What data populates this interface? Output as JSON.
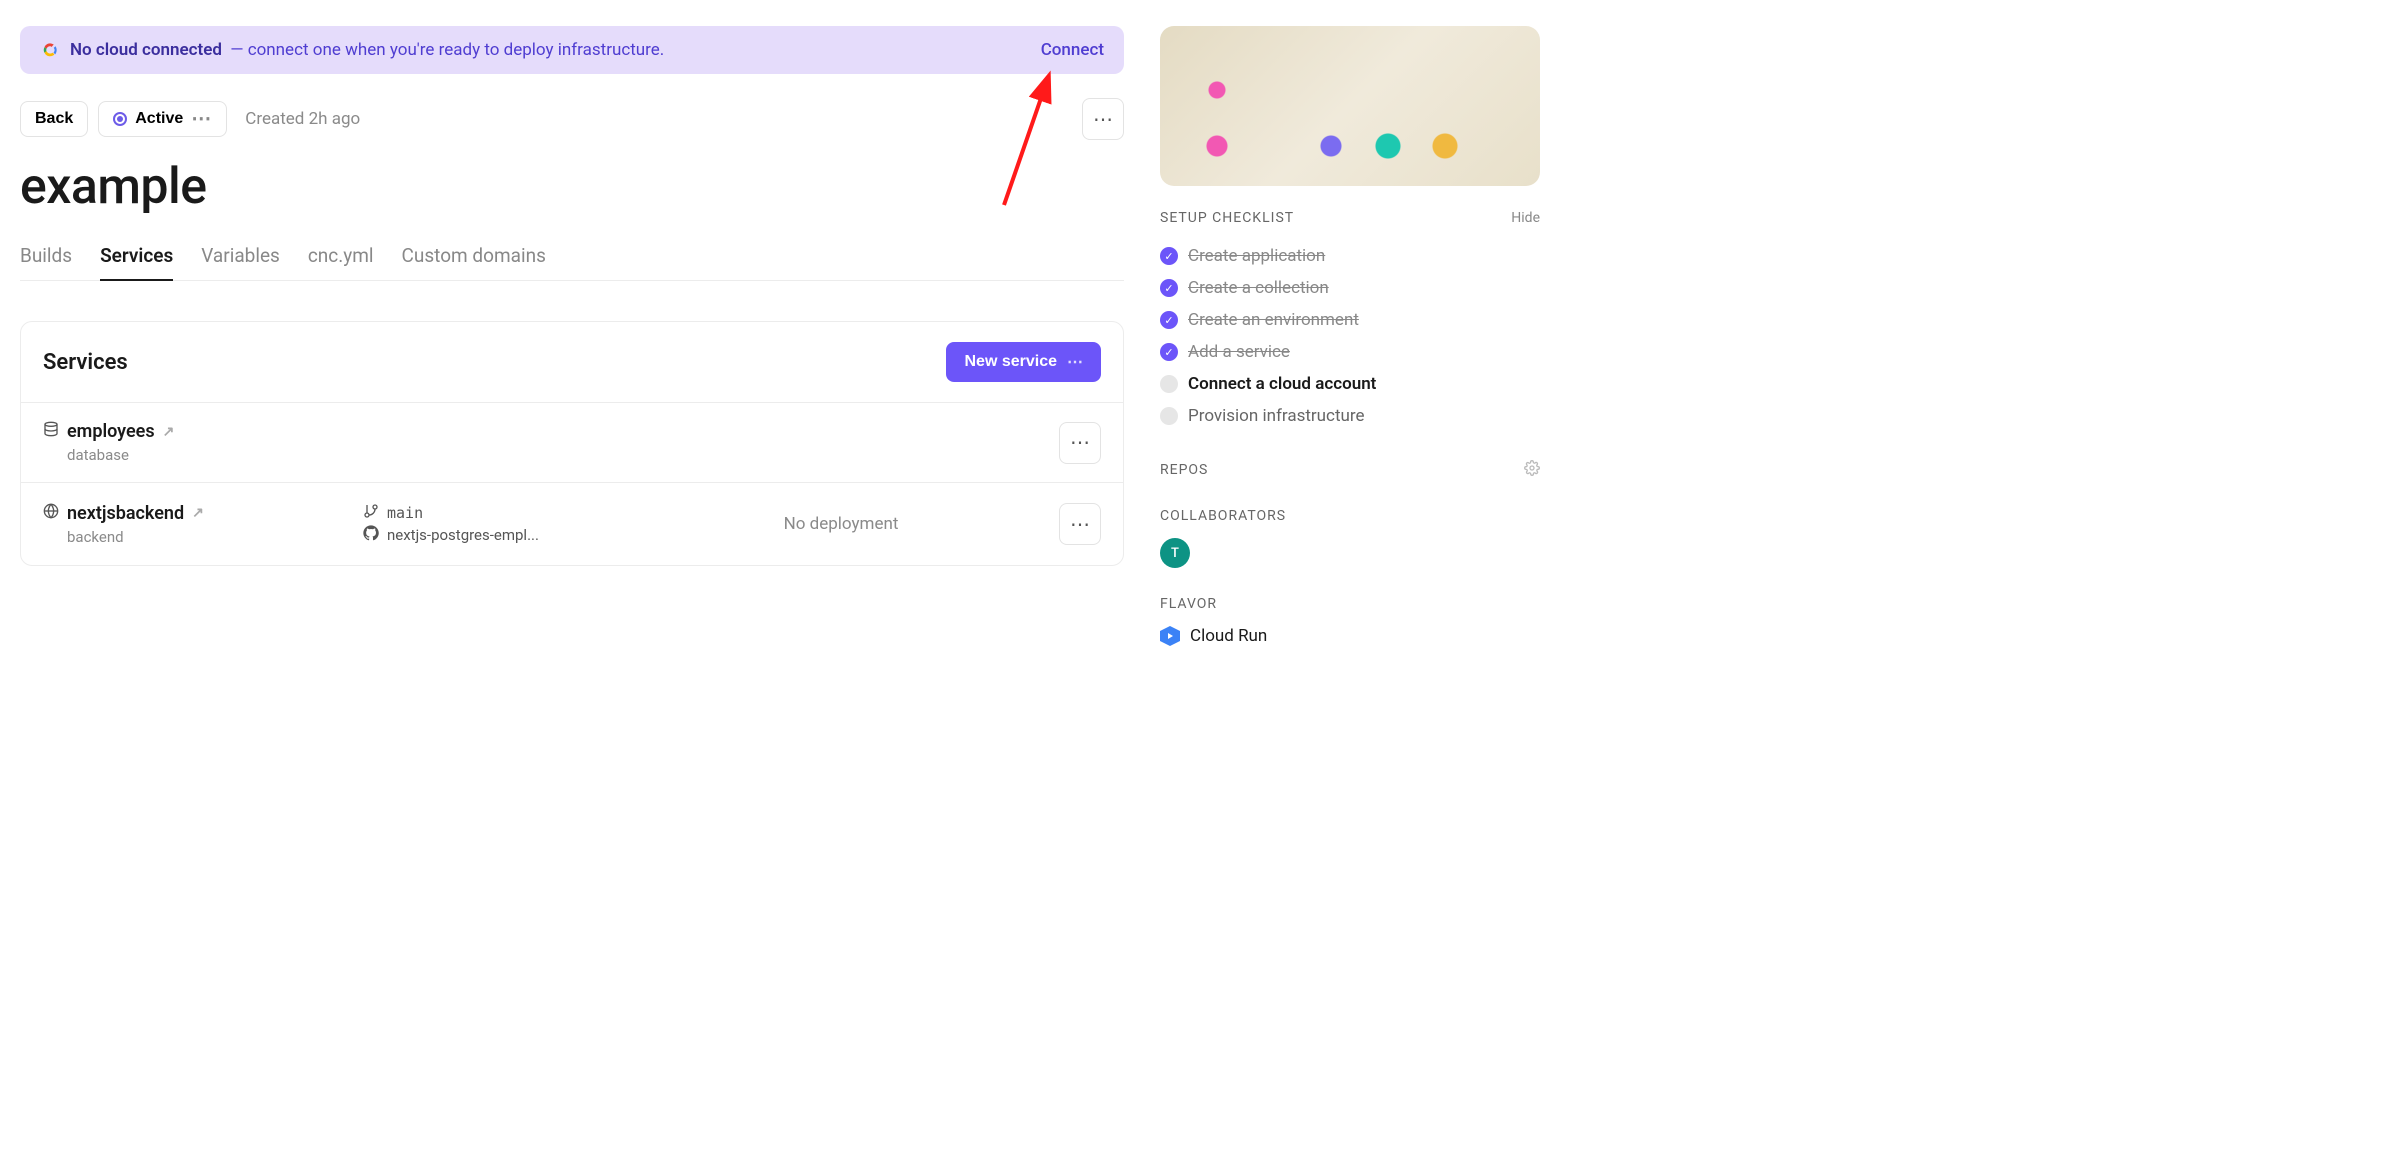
{
  "banner": {
    "bold": "No cloud connected",
    "rest": " — connect one when you're ready to deploy infrastructure.",
    "connect_label": "Connect"
  },
  "header": {
    "back_label": "Back",
    "status_label": "Active",
    "created_text": "Created 2h ago"
  },
  "page_title": "example",
  "tabs": [
    {
      "label": "Builds",
      "active": false
    },
    {
      "label": "Services",
      "active": true
    },
    {
      "label": "Variables",
      "active": false
    },
    {
      "label": "cnc.yml",
      "active": false
    },
    {
      "label": "Custom domains",
      "active": false
    }
  ],
  "services_panel": {
    "title": "Services",
    "new_button": "New service"
  },
  "services": [
    {
      "icon": "database",
      "name": "employees",
      "subtitle": "database",
      "branch": "",
      "repo": "",
      "deployment": ""
    },
    {
      "icon": "globe",
      "name": "nextjsbackend",
      "subtitle": "backend",
      "branch": "main",
      "repo": "nextjs-postgres-empl...",
      "deployment": "No deployment"
    }
  ],
  "checklist": {
    "title": "SETUP CHECKLIST",
    "hide_label": "Hide",
    "items": [
      {
        "label": "Create application",
        "state": "done"
      },
      {
        "label": "Create a collection",
        "state": "done"
      },
      {
        "label": "Create an environment",
        "state": "done"
      },
      {
        "label": "Add a service",
        "state": "done"
      },
      {
        "label": "Connect a cloud account",
        "state": "current"
      },
      {
        "label": "Provision infrastructure",
        "state": "pending"
      }
    ]
  },
  "repos": {
    "title": "REPOS"
  },
  "collaborators": {
    "title": "COLLABORATORS",
    "avatar_initial": "T"
  },
  "flavor": {
    "title": "FLAVOR",
    "value": "Cloud Run"
  }
}
